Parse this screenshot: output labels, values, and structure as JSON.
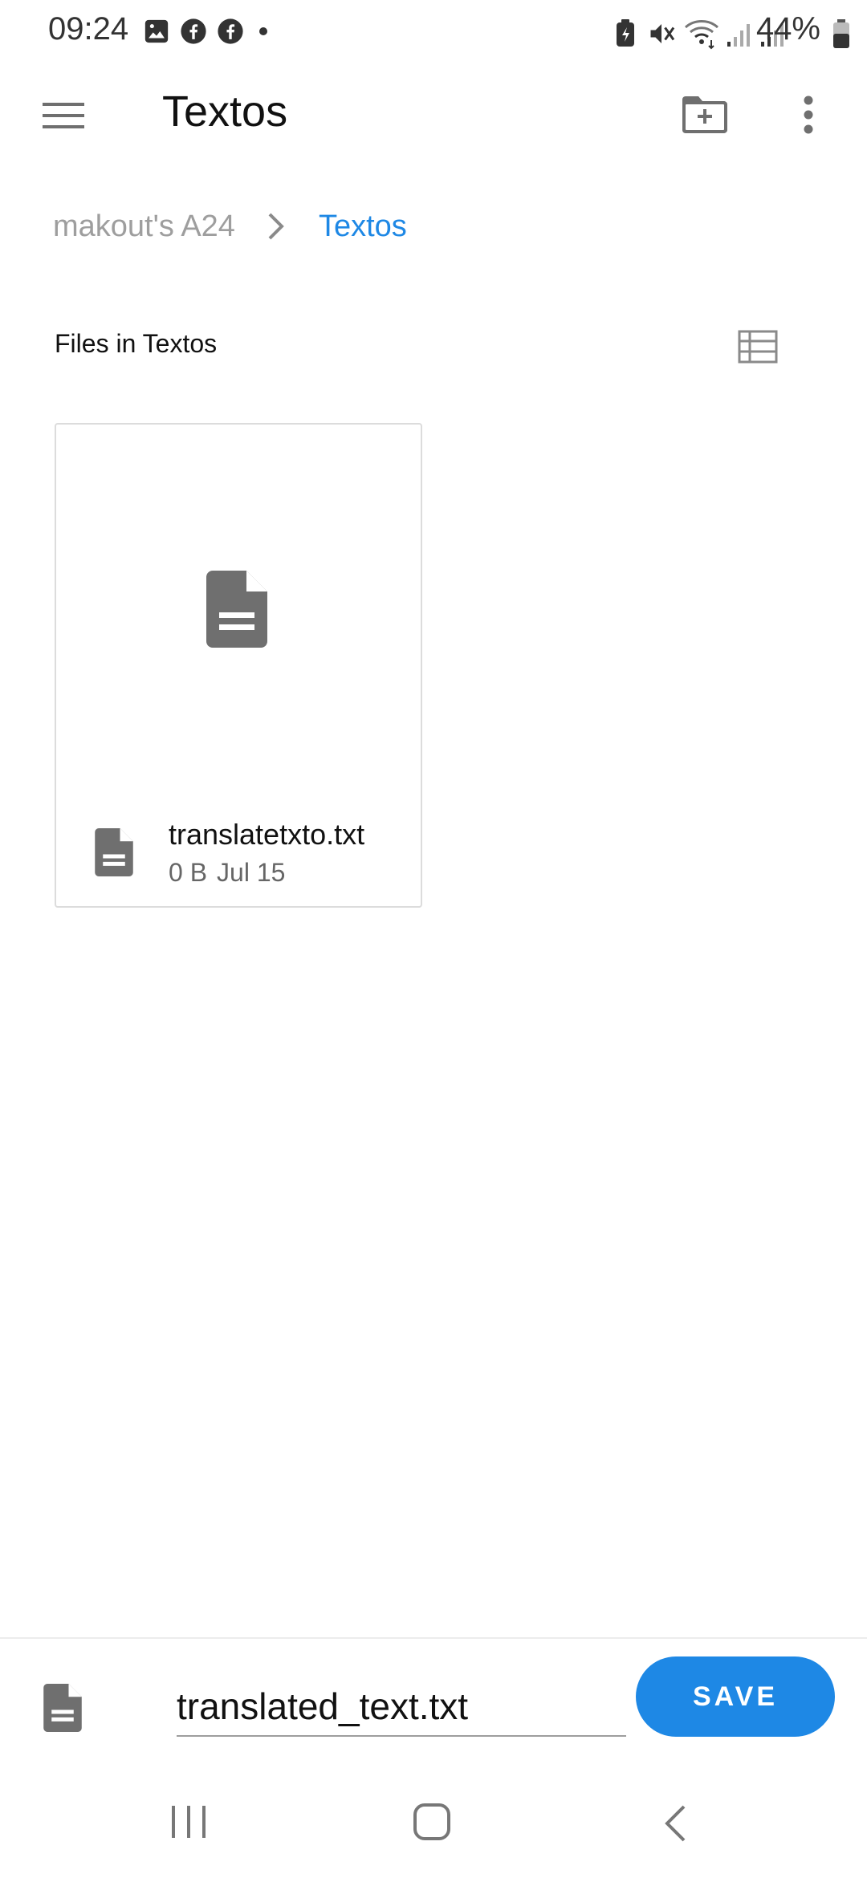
{
  "status_bar": {
    "time": "09:24",
    "battery": "44%",
    "left_icons": [
      "gallery-icon",
      "facebook-icon",
      "facebook-icon",
      "dot-icon"
    ],
    "right_icons": [
      "battery-saver-icon",
      "mute-icon",
      "wifi-icon",
      "signal-icon",
      "signal-icon",
      "battery-icon"
    ]
  },
  "app_bar": {
    "title": "Textos"
  },
  "breadcrumb": {
    "root": "makout's A24",
    "current": "Textos"
  },
  "section": {
    "title": "Files in Textos"
  },
  "files": [
    {
      "name": "translatetxto.txt",
      "size": "0 B",
      "date": "Jul 15"
    }
  ],
  "save_bar": {
    "filename": "translated_text.txt",
    "save_label": "SAVE"
  },
  "colors": {
    "accent": "#1e88e5",
    "icon": "#6f6f6f",
    "muted_text": "#9e9e9e"
  }
}
